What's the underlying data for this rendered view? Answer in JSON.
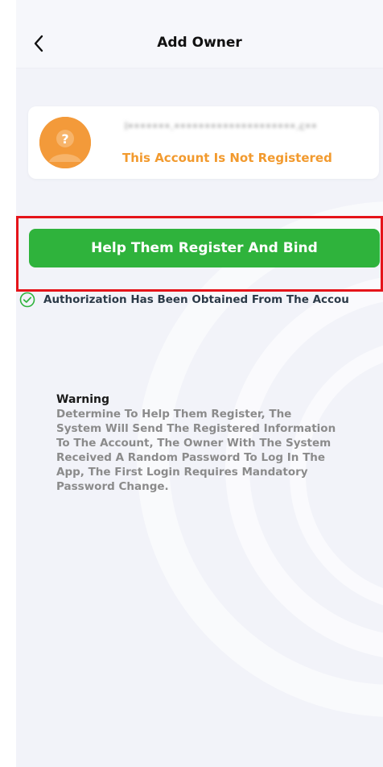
{
  "header": {
    "title": "Add Owner"
  },
  "account": {
    "email": "l•••••••.••••••••••••••••••••.c••",
    "status": "This Account Is Not Registered",
    "status_color": "#f29a2e",
    "avatar_color": "#f39a3a"
  },
  "actions": {
    "register_label": "Help Them Register And Bind",
    "button_color": "#2fb33c",
    "authorization_text": "Authorization Has Been Obtained From The Accou"
  },
  "warning": {
    "title": "Warning",
    "body": "Determine To Help Them Register, The System Will Send The Registered Information To The Account, The Owner With The System Received A Random Password To Log In The App, The First Login Requires Mandatory Password Change."
  },
  "icons": {
    "back": "chevron-left-icon",
    "avatar": "question-user-icon",
    "check": "check-circle-icon"
  }
}
